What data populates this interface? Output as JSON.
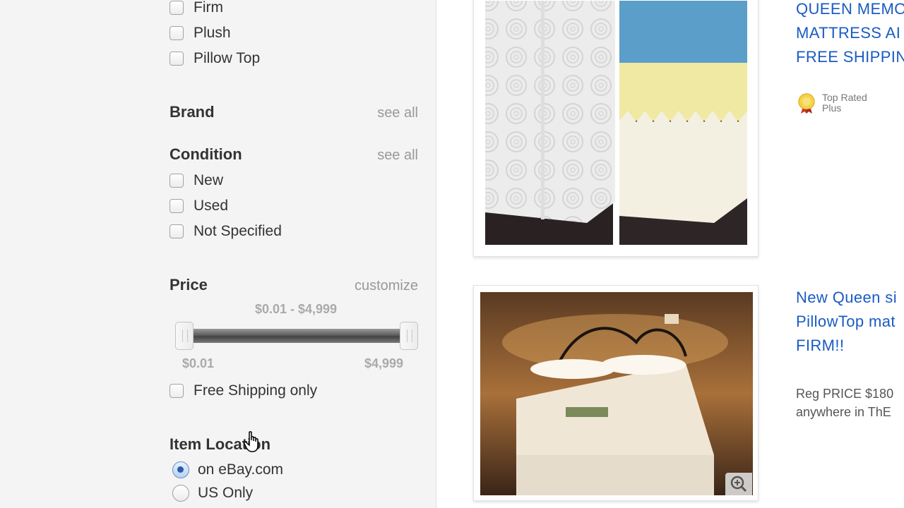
{
  "filters": {
    "firmness_options": [
      {
        "label": "Firm",
        "checked": false
      },
      {
        "label": "Plush",
        "checked": false
      },
      {
        "label": "Pillow Top",
        "checked": false
      }
    ],
    "brand": {
      "title": "Brand",
      "see_all": "see all"
    },
    "condition": {
      "title": "Condition",
      "see_all": "see all",
      "options": [
        {
          "label": "New",
          "checked": false
        },
        {
          "label": "Used",
          "checked": false
        },
        {
          "label": "Not Specified",
          "checked": false
        }
      ]
    },
    "price": {
      "title": "Price",
      "customize": "customize",
      "range_text": "$0.01 - $4,999",
      "min_label": "$0.01",
      "max_label": "$4,999",
      "slider_low_fraction": 0,
      "slider_high_fraction": 1
    },
    "free_shipping": {
      "label": "Free Shipping only",
      "checked": false
    },
    "item_location": {
      "title": "Item Location",
      "options": [
        {
          "label": "on eBay.com",
          "selected": true
        },
        {
          "label": "US Only",
          "selected": false
        }
      ]
    }
  },
  "results": [
    {
      "title_lines": [
        "QUEEN MEMO",
        "MATTRESS AI",
        "FREE SHIPPIN"
      ],
      "badge": {
        "line1": "Top Rated",
        "line2": "Plus"
      }
    },
    {
      "title_lines": [
        "New Queen si",
        "PillowTop mat",
        "FIRM!!"
      ],
      "desc_lines": [
        "Reg PRICE $180",
        "anywhere in ThE"
      ]
    }
  ],
  "colors": {
    "link": "#1a5bc4",
    "sidebar_bg": "#f4f4f4",
    "muted": "#999999"
  }
}
